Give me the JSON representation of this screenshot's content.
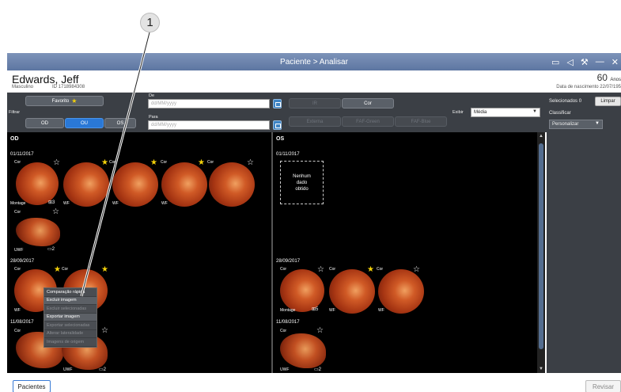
{
  "callout": {
    "number": "1"
  },
  "window": {
    "title": "Paciente > Analisar"
  },
  "patient": {
    "name": "Edwards, Jeff",
    "sex": "Masculino",
    "id": "ID 1718984308",
    "age": "60",
    "age_unit": "Anos",
    "dob_label": "Data de nascimento",
    "dob": "22/07/195"
  },
  "filter": {
    "label": "Filtrar",
    "favorite": "Favorito",
    "eyes": [
      "OD",
      "OU",
      "OS"
    ],
    "from_label": "De",
    "to_label": "Para",
    "date_placeholder": "dd/MM/yyyy",
    "types": [
      "IR",
      "Cor"
    ],
    "channels": [
      "Externa",
      "FAF-Green",
      "FAF-Blue"
    ],
    "show_label": "Exibir",
    "show_value": "Média"
  },
  "right": {
    "selected_label": "Selecionados",
    "selected_count": "0",
    "clear": "Limpar",
    "sort_label": "Classificar",
    "sort_value": "Personalizar"
  },
  "od": {
    "header": "OD",
    "sessions": [
      {
        "date": "01/11/2017",
        "labels": [
          "Cor",
          "Cor",
          "Cor",
          "Cor"
        ],
        "sub": [
          "Montage",
          "WF",
          "WF",
          "WF"
        ],
        "count": "3"
      },
      {
        "labels": [
          "Cor"
        ],
        "sub": [
          "UWF"
        ],
        "count": "2"
      },
      {
        "date": "28/09/2017",
        "labels": [
          "Cor",
          "Cor"
        ],
        "sub": [
          "WF"
        ]
      },
      {
        "date": "11/08/2017",
        "labels": [
          "Cor"
        ],
        "sub": [
          "UWF"
        ],
        "count": "2"
      }
    ]
  },
  "os": {
    "header": "OS",
    "sessions": [
      {
        "date": "01/11/2017",
        "no_data": [
          "Nenhum",
          "dado",
          "obtido"
        ]
      },
      {
        "date": "28/09/2017",
        "labels": [
          "Cor",
          "Cor",
          "Cor"
        ],
        "sub": [
          "Montage",
          "WF",
          "WF"
        ],
        "count": "5"
      },
      {
        "date": "11/08/2017",
        "labels": [
          "Cor"
        ],
        "sub": [
          "UWF"
        ],
        "count": "2"
      }
    ]
  },
  "context_menu": {
    "items": [
      "Comparação rápida",
      "Excluir imagem",
      "Excluir selecionadas",
      "Exportar imagem",
      "Exportar selecionadas",
      "Alterar lateralidade",
      "Imagens de origem"
    ]
  },
  "footer": {
    "patients": "Pacientes",
    "review": "Revisar"
  },
  "colors": {
    "title_bar": "#6a82ab",
    "active": "#2a78d6",
    "panel": "#3b3f45",
    "star": "#f5d20a"
  }
}
